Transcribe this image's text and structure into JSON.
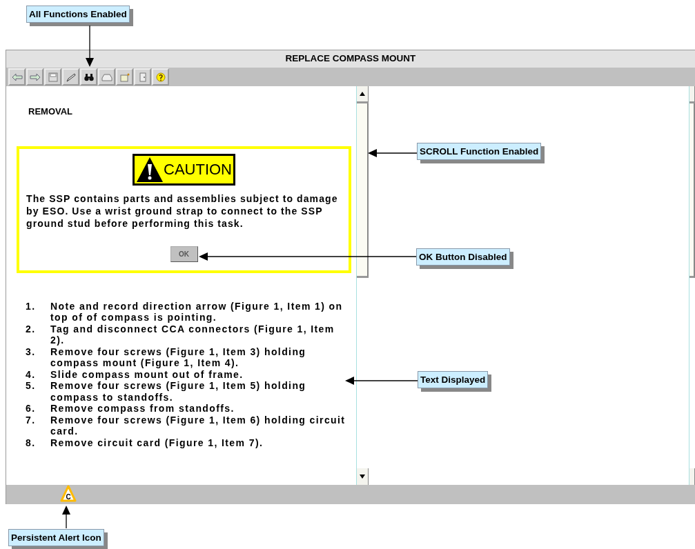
{
  "callouts": [
    {
      "text": "All Functions Enabled"
    },
    {
      "text": "SCROLL Function Enabled"
    },
    {
      "text": "OK Button Disabled"
    },
    {
      "text": "Text Displayed"
    },
    {
      "text": "Persistent Alert Icon"
    }
  ],
  "window": {
    "title": "REPLACE COMPASS MOUNT",
    "content": {
      "heading": "REMOVAL",
      "caution": {
        "label": "CAUTION",
        "text": "The SSP contains parts and assemblies subject to damage by ESO. Use a wrist ground strap to connect to the SSP ground stud before performing this task.",
        "ok_button": {
          "label": "OK",
          "disabled": true
        }
      },
      "steps": [
        {
          "number": "1.",
          "text": "Note and record direction arrow (Figure 1, Item 1) on top of of compass is pointing."
        },
        {
          "number": "2.",
          "text": "Tag and disconnect CCA connectors (Figure 1, Item 2)."
        },
        {
          "number": "3.",
          "text": "Remove four screws (Figure 1, Item 3) holding compass mount (Figure 1, Item 4)."
        },
        {
          "number": "4.",
          "text": "Slide compass mount out of frame."
        },
        {
          "number": "5.",
          "text": "Remove four screws (Figure 1, Item 5) holding compass to standoffs."
        },
        {
          "number": "6.",
          "text": "Remove compass from standoffs."
        },
        {
          "number": "7.",
          "text": "Remove four screws (Figure 1, Item 6)  holding circuit card."
        },
        {
          "number": "8.",
          "text": "Remove circuit card (Figure 1, Item 7)."
        }
      ]
    },
    "status_bar": {
      "alert_icon": {
        "letter": "C"
      }
    }
  }
}
